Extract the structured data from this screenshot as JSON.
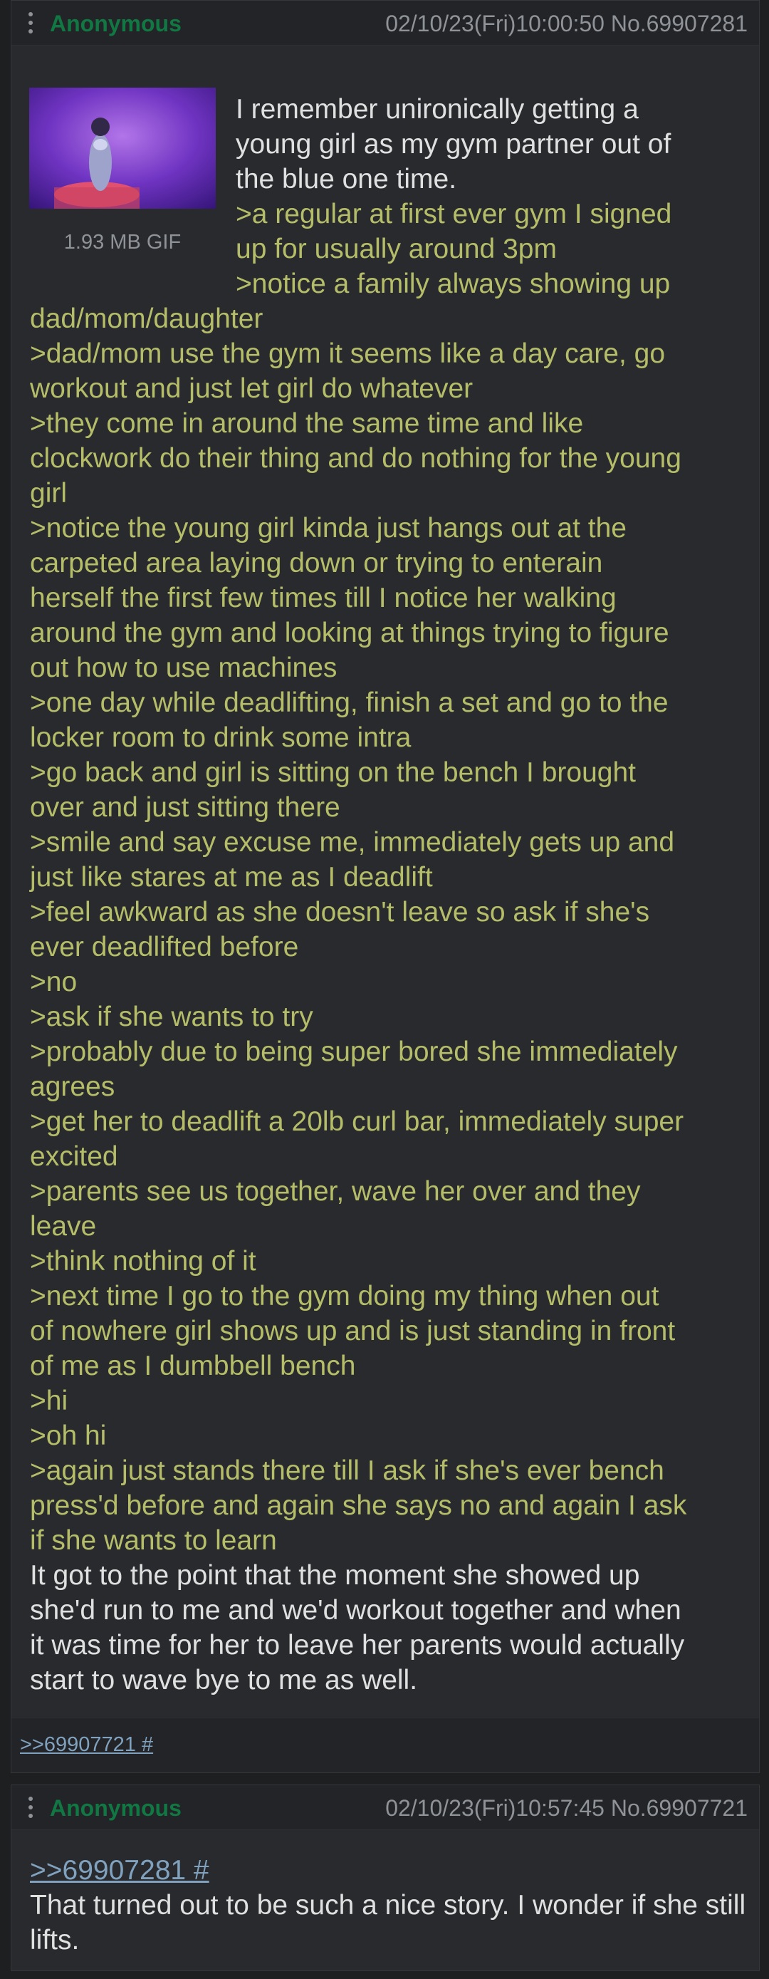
{
  "posts": [
    {
      "name": "Anonymous",
      "meta": "02/10/23(Fri)10:00:50 No.69907281",
      "file": {
        "info": "1.93 MB GIF"
      },
      "lines": [
        {
          "text": "I remember unironically getting a",
          "greentext": false
        },
        {
          "text": "young girl as my gym partner out of",
          "greentext": false
        },
        {
          "text": "the blue one time.",
          "greentext": false
        },
        {
          "text": ">a regular at first ever gym I signed",
          "greentext": true
        },
        {
          "text": "up for usually around 3pm",
          "greentext": true
        },
        {
          "text": ">notice a family always showing up",
          "greentext": true
        },
        {
          "text": "dad/mom/daughter",
          "greentext": true
        },
        {
          "text": ">dad/mom use the gym it seems like a day care, go",
          "greentext": true
        },
        {
          "text": "workout and just let girl do whatever",
          "greentext": true
        },
        {
          "text": ">they come in around the same time and like",
          "greentext": true
        },
        {
          "text": "clockwork do their thing and do nothing for the young",
          "greentext": true
        },
        {
          "text": "girl",
          "greentext": true
        },
        {
          "text": ">notice the young girl kinda just hangs out at the",
          "greentext": true
        },
        {
          "text": "carpeted area laying down or trying to enterain",
          "greentext": true
        },
        {
          "text": "herself the first few times till I notice her walking",
          "greentext": true
        },
        {
          "text": "around the gym and looking at things trying to figure",
          "greentext": true
        },
        {
          "text": "out how to use machines",
          "greentext": true
        },
        {
          "text": ">one day while deadlifting, finish a set and go to the",
          "greentext": true
        },
        {
          "text": "locker room to drink some intra",
          "greentext": true
        },
        {
          "text": ">go back and girl is sitting on the bench I brought",
          "greentext": true
        },
        {
          "text": "over and just sitting there",
          "greentext": true
        },
        {
          "text": ">smile and say excuse me, immediately gets up and",
          "greentext": true
        },
        {
          "text": "just like stares at me as I deadlift",
          "greentext": true
        },
        {
          "text": ">feel awkward as she doesn't leave so ask if she's",
          "greentext": true
        },
        {
          "text": "ever deadlifted before",
          "greentext": true
        },
        {
          "text": ">no",
          "greentext": true
        },
        {
          "text": ">ask if she wants to try",
          "greentext": true
        },
        {
          "text": ">probably due to being super bored she immediately",
          "greentext": true
        },
        {
          "text": "agrees",
          "greentext": true
        },
        {
          "text": ">get her to deadlift a 20lb curl bar, immediately super",
          "greentext": true
        },
        {
          "text": "excited",
          "greentext": true
        },
        {
          "text": ">parents see us together, wave her over and they",
          "greentext": true
        },
        {
          "text": "leave",
          "greentext": true
        },
        {
          "text": ">think nothing of it",
          "greentext": true
        },
        {
          "text": ">next time I go to the gym doing my thing when out",
          "greentext": true
        },
        {
          "text": "of nowhere girl shows up and is just standing in front",
          "greentext": true
        },
        {
          "text": "of me as I dumbbell bench",
          "greentext": true
        },
        {
          "text": ">hi",
          "greentext": true
        },
        {
          "text": ">oh hi",
          "greentext": true
        },
        {
          "text": ">again just stands there till I ask if she's ever bench",
          "greentext": true
        },
        {
          "text": "press'd before and again she says no and again I ask",
          "greentext": true
        },
        {
          "text": "if she wants to learn",
          "greentext": true
        },
        {
          "text": "It got to the point that the moment she showed up",
          "greentext": false
        },
        {
          "text": "she'd run to me and we'd workout together and when",
          "greentext": false
        },
        {
          "text": "it was time for her to leave her parents would actually",
          "greentext": false
        },
        {
          "text": "start to wave bye to me as well.",
          "greentext": false
        }
      ],
      "replies": [
        ">>69907721 #"
      ]
    },
    {
      "name": "Anonymous",
      "meta": "02/10/23(Fri)10:57:45 No.69907721",
      "quote": ">>69907281 #",
      "lines": [
        {
          "text": "That turned out to be such a nice story. I wonder if she still",
          "greentext": false
        },
        {
          "text": "lifts.",
          "greentext": false
        }
      ]
    }
  ],
  "colors": {
    "background": "#1d1f21",
    "post": "#282a2e",
    "name": "#117743",
    "greentext": "#b5bd68",
    "link": "#81a2be",
    "text": "#dfe1e0",
    "meta": "#8f9398"
  },
  "icons": [
    "kebab-menu-icon"
  ]
}
